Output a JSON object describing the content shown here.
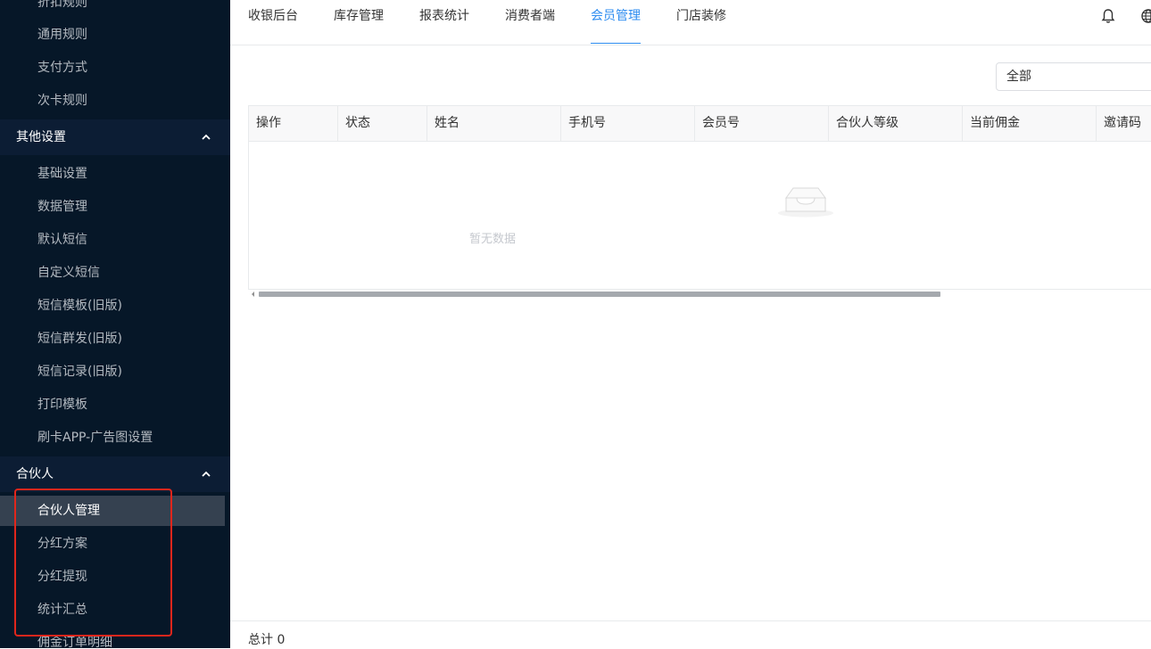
{
  "sidebar": {
    "items_top": [
      {
        "label": "折扣规则"
      },
      {
        "label": "通用规则"
      },
      {
        "label": "支付方式"
      },
      {
        "label": "次卡规则"
      }
    ],
    "group_other": {
      "label": "其他设置"
    },
    "items_other": [
      {
        "label": "基础设置"
      },
      {
        "label": "数据管理"
      },
      {
        "label": "默认短信"
      },
      {
        "label": "自定义短信"
      },
      {
        "label": "短信模板(旧版)"
      },
      {
        "label": "短信群发(旧版)"
      },
      {
        "label": "短信记录(旧版)"
      },
      {
        "label": "打印模板"
      },
      {
        "label": "刷卡APP-广告图设置"
      }
    ],
    "group_partner": {
      "label": "合伙人"
    },
    "items_partner": [
      {
        "label": "合伙人管理"
      },
      {
        "label": "分红方案"
      },
      {
        "label": "分红提现"
      },
      {
        "label": "统计汇总"
      },
      {
        "label": "佣金订单明细"
      }
    ]
  },
  "topnav": {
    "tabs": [
      {
        "label": "收银后台"
      },
      {
        "label": "库存管理"
      },
      {
        "label": "报表统计"
      },
      {
        "label": "消费者端"
      },
      {
        "label": "会员管理"
      },
      {
        "label": "门店装修"
      }
    ],
    "active_tab": "会员管理",
    "icons": [
      "bell-icon",
      "globe-icon"
    ]
  },
  "filter": {
    "selected": "全部"
  },
  "table": {
    "columns": [
      "操作",
      "状态",
      "姓名",
      "手机号",
      "会员号",
      "合伙人等级",
      "当前佣金",
      "邀请码"
    ],
    "rows": [],
    "empty_text": "暂无数据"
  },
  "footer": {
    "total": "总计 0"
  },
  "colors": {
    "sidebar_bg": "#061728",
    "accent": "#2d8cf0",
    "annotation": "#e0261c"
  }
}
